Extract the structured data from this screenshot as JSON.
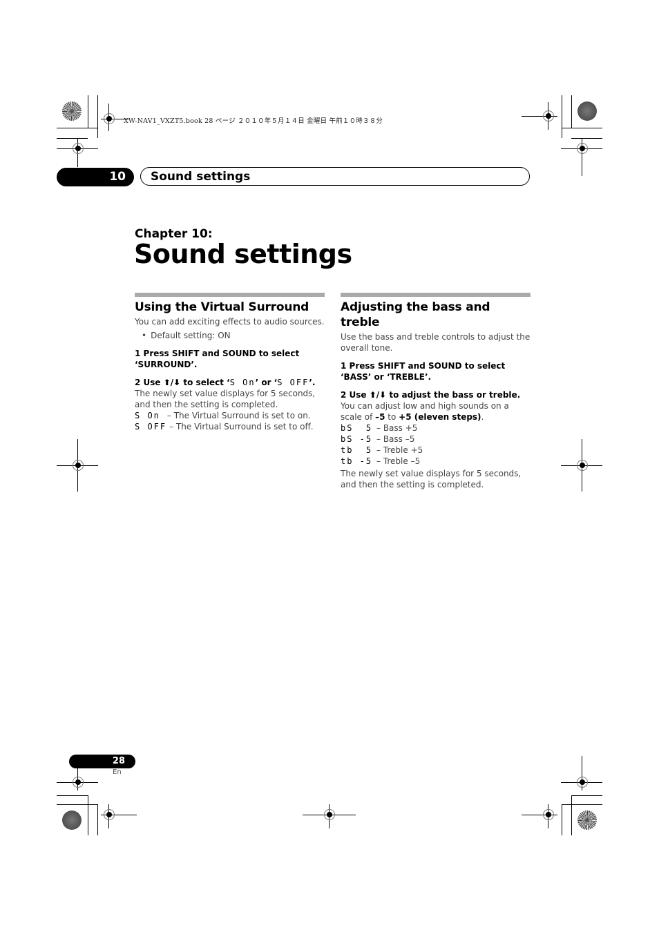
{
  "print_header": {
    "text": "XW-NAV1_VXZT5.book  28 ページ  ２０１０年５月１４日  金曜日  午前１０時３８分"
  },
  "running_head": {
    "chapter_number": "10",
    "title": "Sound settings"
  },
  "chapter": {
    "label": "Chapter 10:",
    "title": "Sound settings"
  },
  "left_section": {
    "heading": "Using the Virtual Surround",
    "intro": "You can add exciting effects to audio sources.",
    "bullet": "Default setting: ON",
    "step1": "1    Press SHIFT and SOUND to select ‘SURROUND’.",
    "step2_prefix": "2    Use ⬆/⬇ to select ‘",
    "step2_lcd_on": "S On",
    "step2_mid": "’ or ‘",
    "step2_lcd_off": "S OFF",
    "step2_suffix": "’.",
    "step2_body": "The newly set value displays for 5 seconds, and then the setting is completed.",
    "options": [
      {
        "lcd": "S On",
        "desc": "– The Virtual Surround is set to on."
      },
      {
        "lcd": "S OFF",
        "desc": "– The Virtual Surround is set to off."
      }
    ]
  },
  "right_section": {
    "heading": "Adjusting the bass and treble",
    "intro": "Use the bass and treble controls to adjust the overall tone.",
    "step1": "1    Press SHIFT and SOUND to select ‘BASS’ or ‘TREBLE’.",
    "step2": "2    Use ⬆/⬇ to adjust the bass or treble.",
    "step2_body_a": "You can adjust low and high sounds on a scale of ",
    "step2_min": "–5",
    "step2_to": " to ",
    "step2_max": "+5 (eleven steps)",
    "step2_end": ".",
    "options": [
      {
        "lcd": "bS  5",
        "desc": "– Bass +5"
      },
      {
        "lcd": "bS -5",
        "desc": "– Bass –5"
      },
      {
        "lcd": "tb  5",
        "desc": "– Treble +5"
      },
      {
        "lcd": "tb -5",
        "desc": "– Treble –5"
      }
    ],
    "footer": "The newly set value displays for 5 seconds, and then the setting is completed."
  },
  "footer": {
    "page_number": "28",
    "language": "En"
  }
}
